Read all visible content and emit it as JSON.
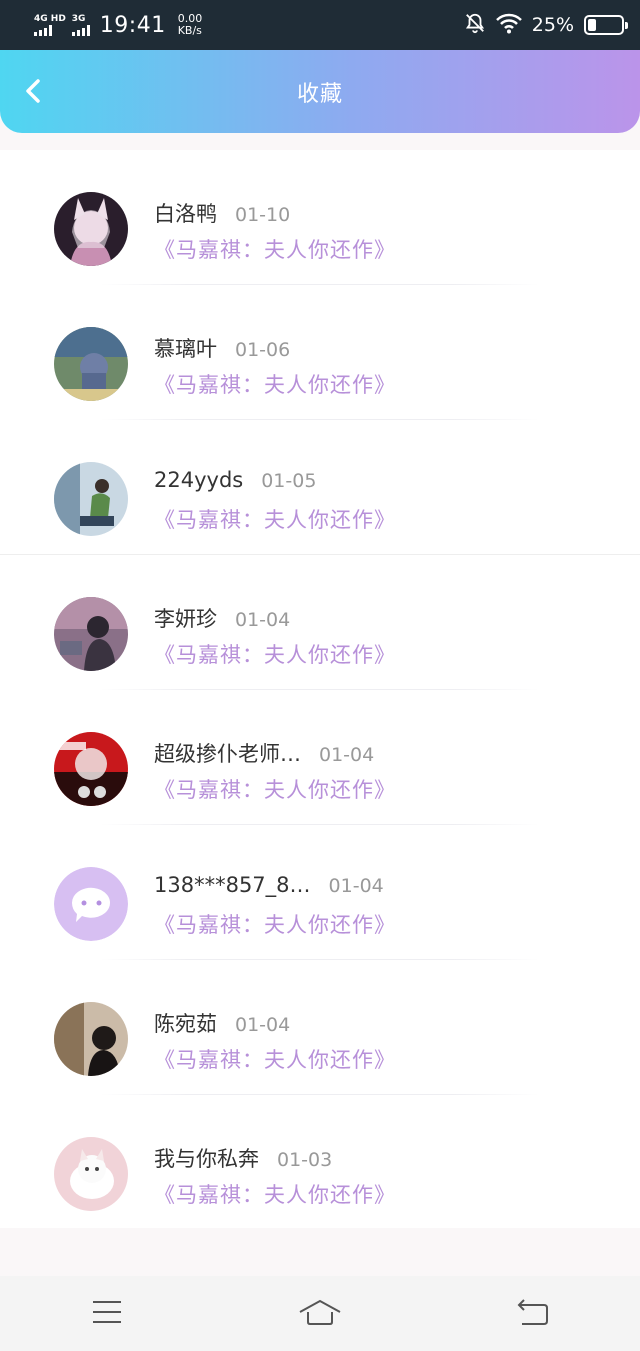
{
  "status_bar": {
    "net1": "4G HD",
    "net2": "3G",
    "time": "19:41",
    "speed_value": "0.00",
    "speed_unit": "KB/s",
    "battery_percent": "25%",
    "icons": [
      "signal-bars-icon",
      "mute-bell-icon",
      "wifi-icon",
      "battery-icon"
    ]
  },
  "header": {
    "title": "收藏",
    "back_icon": "chevron-left-icon"
  },
  "favorites": [
    {
      "name": "白洛鸭",
      "date": "01-10",
      "title": "《马嘉祺：夫人你还作》"
    },
    {
      "name": "慕璃叶",
      "date": "01-06",
      "title": "《马嘉祺：夫人你还作》"
    },
    {
      "name": "224yyds",
      "date": "01-05",
      "title": "《马嘉祺：夫人你还作》"
    },
    {
      "name": "李妍珍",
      "date": "01-04",
      "title": "《马嘉祺：夫人你还作》"
    },
    {
      "name": "超级掺仆老师…",
      "date": "01-04",
      "title": "《马嘉祺：夫人你还作》"
    },
    {
      "name": "138***857_8…",
      "date": "01-04",
      "title": "《马嘉祺：夫人你还作》"
    },
    {
      "name": "陈宛茹",
      "date": "01-04",
      "title": "《马嘉祺：夫人你还作》"
    },
    {
      "name": "我与你私奔",
      "date": "01-03",
      "title": "《马嘉祺：夫人你还作》"
    }
  ],
  "nav_bar": {
    "icons": [
      "menu-icon",
      "home-icon",
      "back-icon"
    ]
  },
  "colors": {
    "header_gradient_start": "#4fd6f1",
    "header_gradient_end": "#bb94ea",
    "title_accent": "#b790d9",
    "default_avatar": "#d7bff2"
  }
}
